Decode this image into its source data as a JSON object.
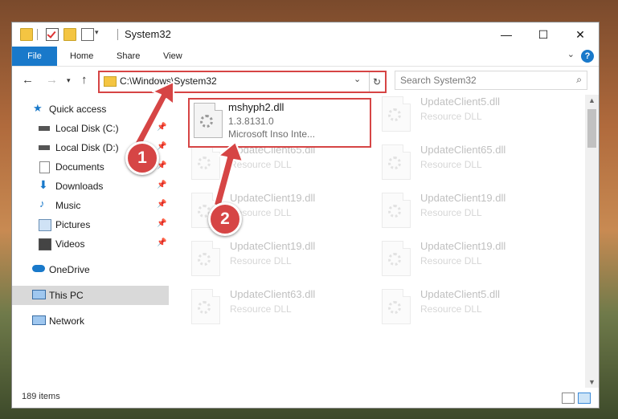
{
  "window": {
    "title": "System32"
  },
  "ribbon": {
    "tabs": [
      "File",
      "Home",
      "Share",
      "View"
    ],
    "help": "?"
  },
  "address": {
    "path": "C:\\Windows\\System32",
    "search_placeholder": "Search System32"
  },
  "nav": {
    "items": [
      {
        "label": "Quick access"
      },
      {
        "label": "Local Disk (C:)"
      },
      {
        "label": "Local Disk (D:)"
      },
      {
        "label": "Documents"
      },
      {
        "label": "Downloads"
      },
      {
        "label": "Music"
      },
      {
        "label": "Pictures"
      },
      {
        "label": "Videos"
      },
      {
        "label": "OneDrive"
      },
      {
        "label": "This PC"
      },
      {
        "label": "Network"
      }
    ]
  },
  "files": {
    "selected": {
      "name": "mshyph2.dll",
      "version": "1.3.8131.0",
      "company": "Microsoft Inso Inte..."
    },
    "left": [
      {
        "name": "UpdateClient65.dll",
        "type": "Resource DLL"
      },
      {
        "name": "UpdateClient19.dll",
        "type": "Resource DLL"
      },
      {
        "name": "UpdateClient19.dll",
        "type": "Resource DLL"
      },
      {
        "name": "UpdateClient63.dll",
        "type": "Resource DLL"
      }
    ],
    "right": [
      {
        "name": "UpdateClient5.dll",
        "type": "Resource DLL"
      },
      {
        "name": "UpdateClient65.dll",
        "type": "Resource DLL"
      },
      {
        "name": "UpdateClient19.dll",
        "type": "Resource DLL"
      },
      {
        "name": "UpdateClient19.dll",
        "type": "Resource DLL"
      },
      {
        "name": "UpdateClient5.dll",
        "type": "Resource DLL"
      }
    ]
  },
  "status": {
    "count": "189 items"
  },
  "annotations": {
    "step1": "1",
    "step2": "2",
    "color": "#d64545"
  }
}
